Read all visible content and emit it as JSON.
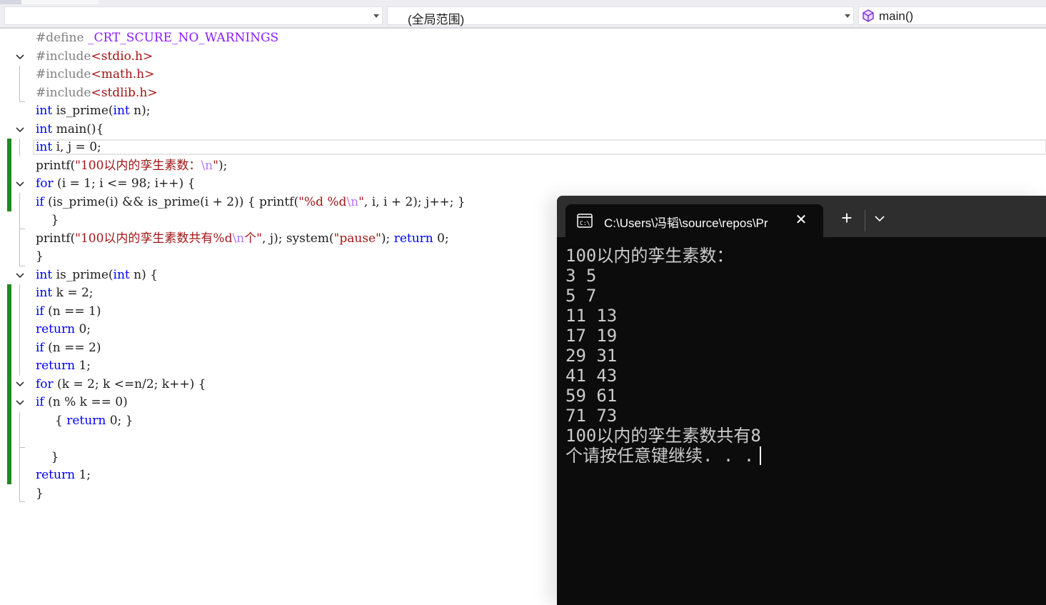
{
  "navbar": {
    "scope_combo": "(全局范围)",
    "member_combo": "main()"
  },
  "editor": {
    "lines": [
      "#define _CRT_SCURE_NO_WARNINGS",
      "#include<stdio.h>",
      "#include<math.h>",
      "#include<stdlib.h>",
      "int is_prime(int n);",
      "int main(){",
      "int i, j = 0;",
      "printf(\"100以内的孪生素数：\\n\");",
      "for (i = 1; i <= 98; i++) {",
      "if (is_prime(i) && is_prime(i + 2)) { printf(\"%d %d\\n\", i, i + 2); j++; }",
      "    }",
      "printf(\"100以内的孪生素数共有%d\\n个\", j); system(\"pause\"); return 0;",
      "}",
      "int is_prime(int n) {",
      "int k = 2;",
      "if (n == 1)",
      "return 0;",
      "if (n == 2)",
      "return 1;",
      "for (k = 2; k <=n/2; k++) {",
      "if (n % k == 0)",
      "     { return 0; }",
      "",
      "    }",
      "return 1;",
      "}"
    ]
  },
  "terminal": {
    "tab_title": "C:\\Users\\冯韬\\source\\repos\\Pr",
    "close_label": "✕",
    "new_tab_label": "+",
    "output_lines": [
      "100以内的孪生素数：",
      "3 5",
      "5 7",
      "11 13",
      "17 19",
      "29 31",
      "41 43",
      "59 61",
      "71 73",
      "100以内的孪生素数共有8",
      "个请按任意键继续. . ."
    ]
  },
  "colors": {
    "keyword": "#0000ff",
    "string": "#a31515",
    "preprocessor": "#808080",
    "change_bar": "#1f8a1f",
    "terminal_bg": "#0c0c0c"
  }
}
